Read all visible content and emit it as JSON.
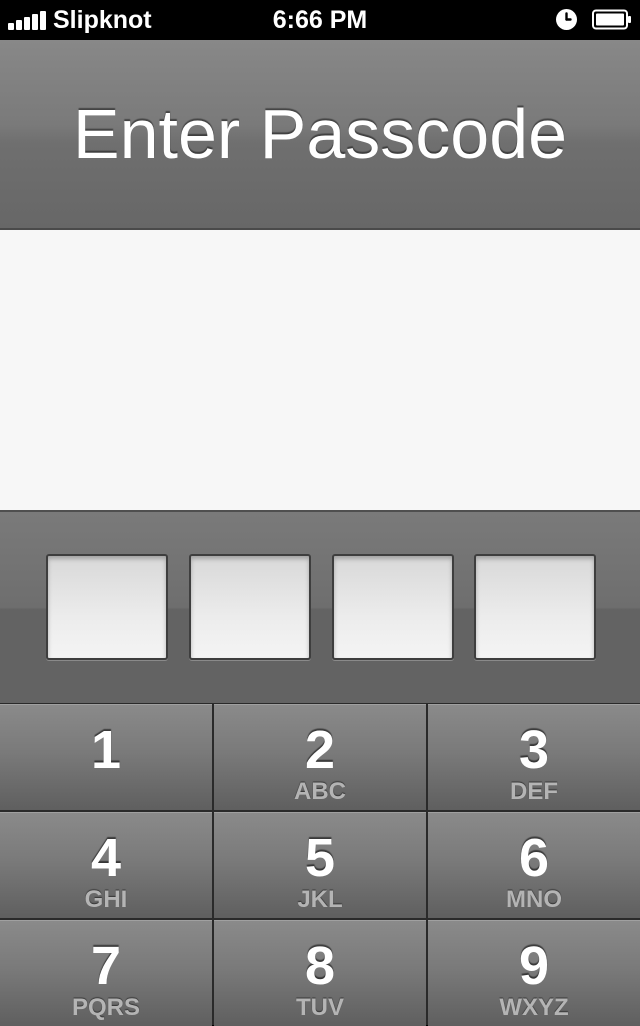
{
  "status_bar": {
    "carrier": "Slipknot",
    "time": "6:66 PM",
    "signal_bars": 5,
    "icons": [
      "signal-icon",
      "alarm-icon",
      "battery-icon"
    ]
  },
  "header": {
    "title": "Enter Passcode"
  },
  "passcode": {
    "digit_count": 4,
    "entered": ""
  },
  "keypad": {
    "keys": [
      {
        "digit": "1",
        "letters": ""
      },
      {
        "digit": "2",
        "letters": "ABC"
      },
      {
        "digit": "3",
        "letters": "DEF"
      },
      {
        "digit": "4",
        "letters": "GHI"
      },
      {
        "digit": "5",
        "letters": "JKL"
      },
      {
        "digit": "6",
        "letters": "MNO"
      },
      {
        "digit": "7",
        "letters": "PQRS"
      },
      {
        "digit": "8",
        "letters": "TUV"
      },
      {
        "digit": "9",
        "letters": "WXYZ"
      }
    ]
  },
  "colors": {
    "header": "#7a7a7a",
    "message_area": "#f7f7f7",
    "key": "#7a7a7a",
    "key_letters": "#b4b4b4"
  }
}
